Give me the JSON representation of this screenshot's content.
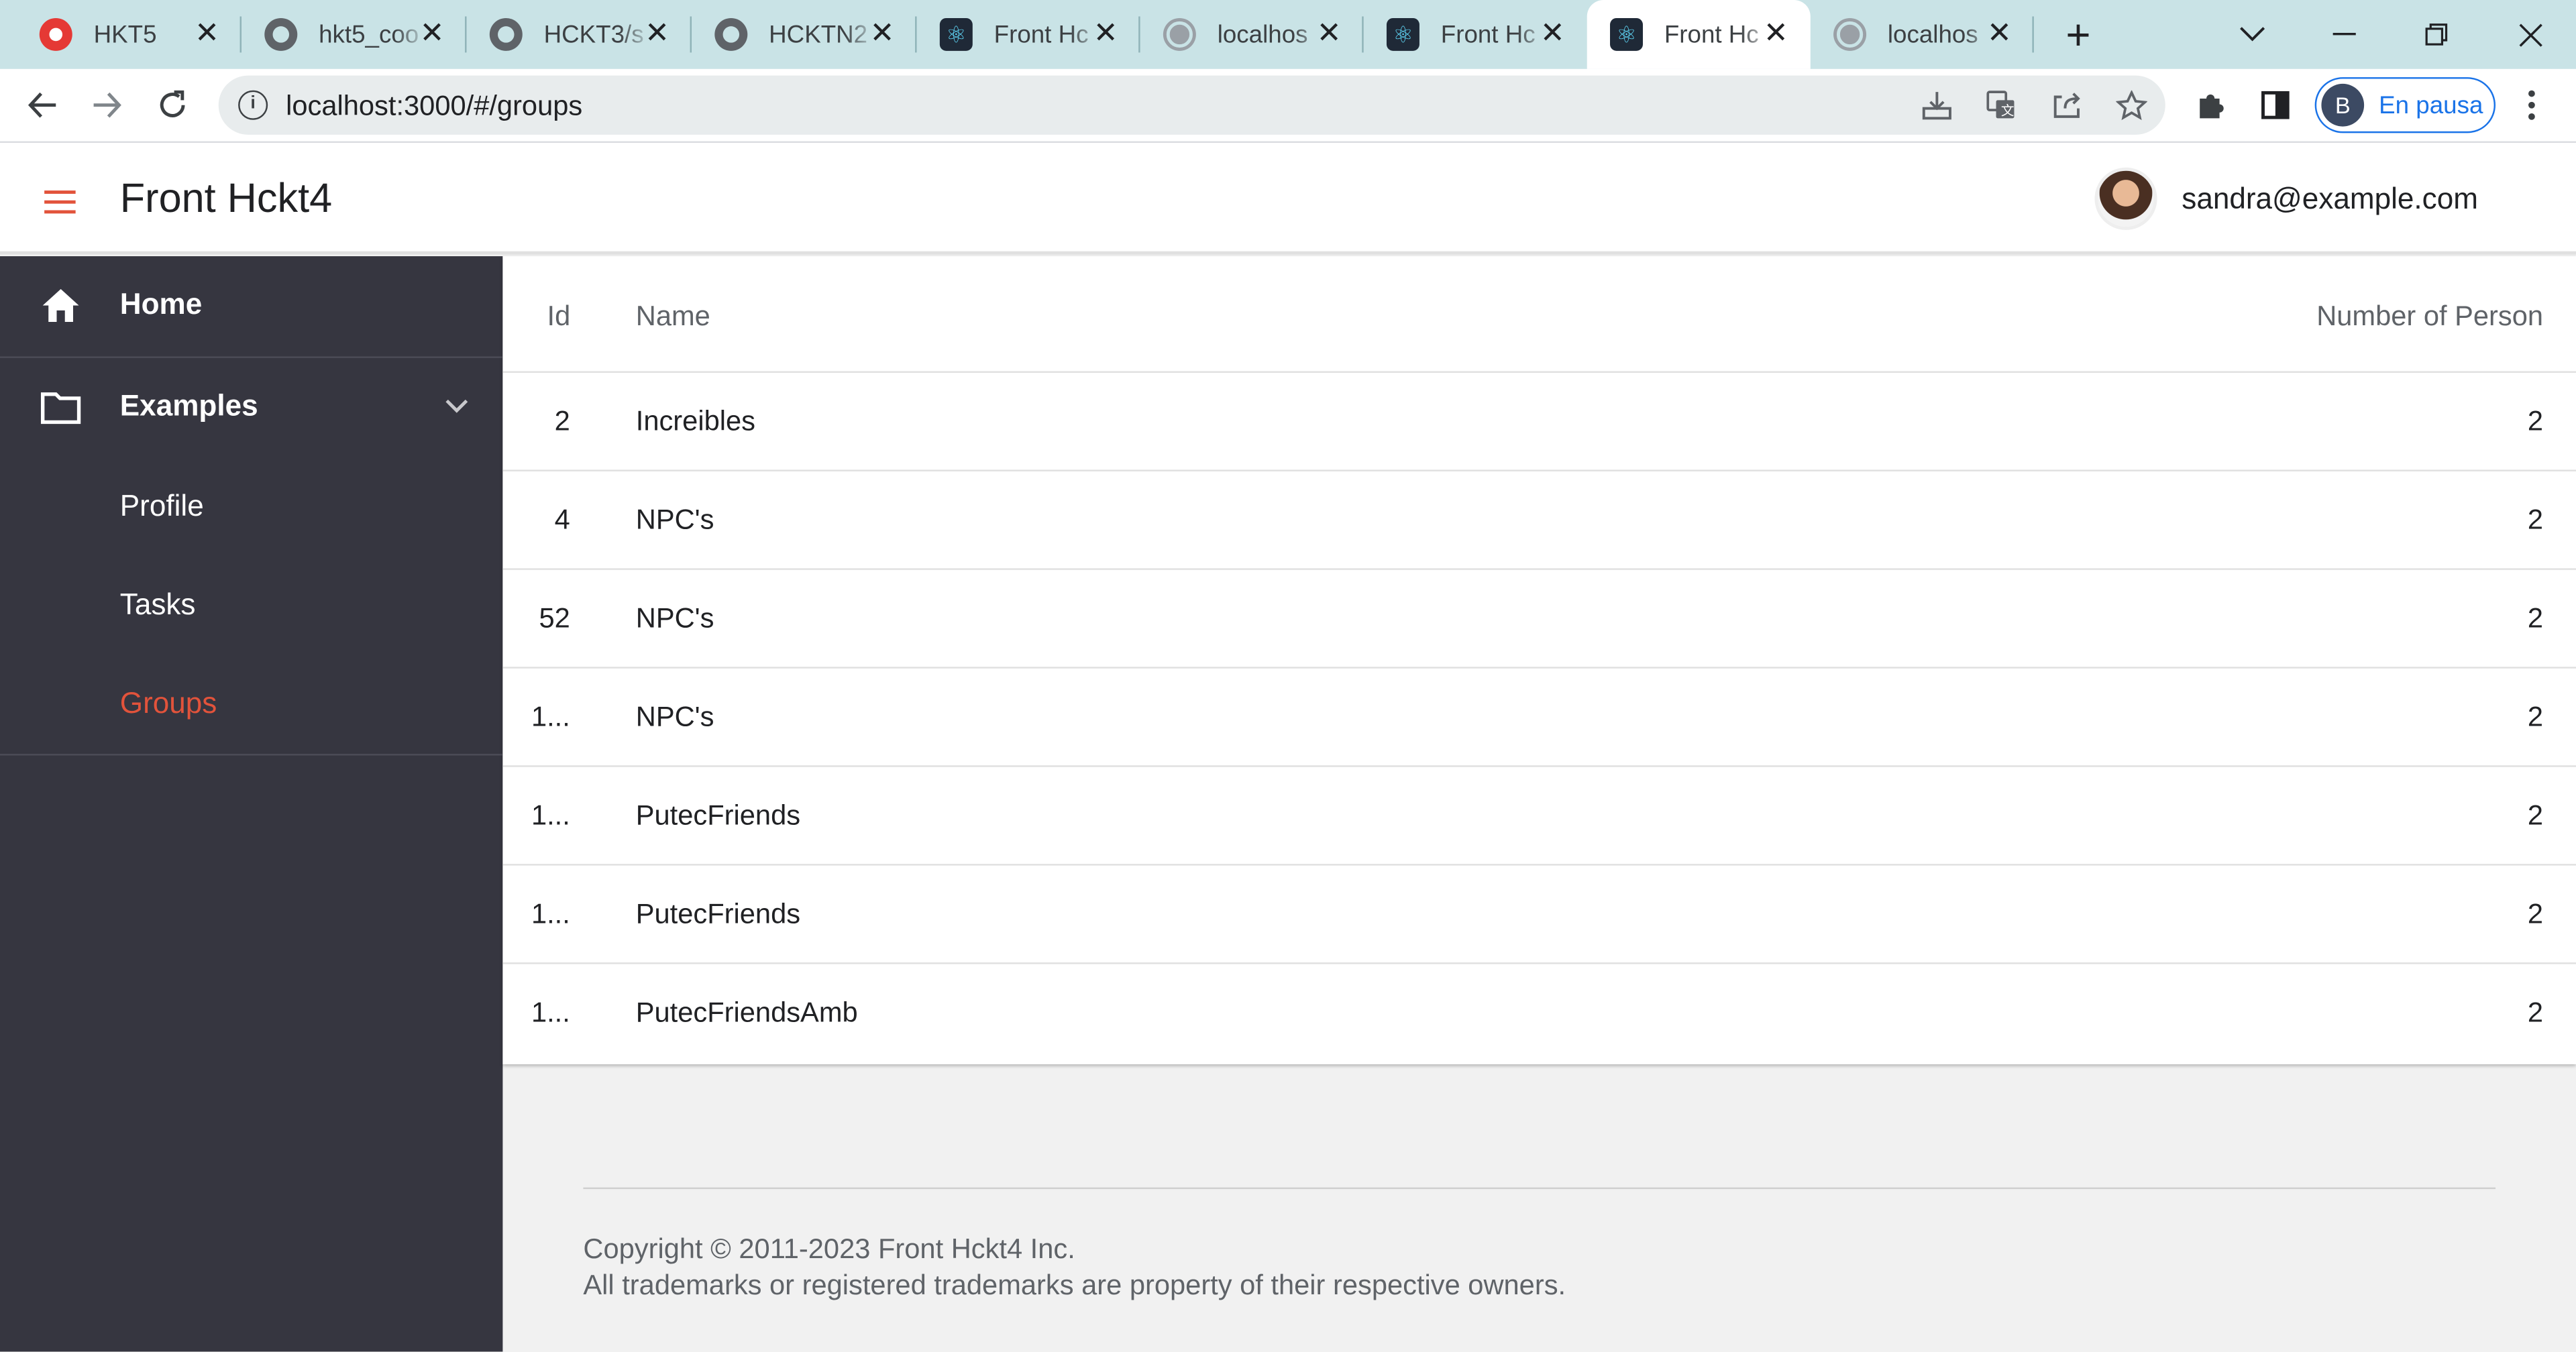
{
  "browser": {
    "tabs": [
      {
        "title": "HKT5",
        "icon": "hkt-favicon",
        "active": false
      },
      {
        "title": "hkt5_coo",
        "icon": "github-favicon",
        "active": false
      },
      {
        "title": "HCKT3/s",
        "icon": "github-favicon",
        "active": false
      },
      {
        "title": "HCKTN2",
        "icon": "github-favicon",
        "active": false
      },
      {
        "title": "Front Hc",
        "icon": "react-favicon",
        "active": false
      },
      {
        "title": "localhos",
        "icon": "globe-favicon",
        "active": false
      },
      {
        "title": "Front Hc",
        "icon": "react-favicon",
        "active": false
      },
      {
        "title": "Front Hc",
        "icon": "react-favicon",
        "active": true
      },
      {
        "title": "localhos",
        "icon": "globe-favicon",
        "active": false
      }
    ],
    "url": "localhost:3000/#/groups",
    "profile_initial": "B",
    "profile_status": "En pausa",
    "accent": "#1a73e8",
    "tabstrip_color": "#c9e3e6"
  },
  "app": {
    "title": "Front Hckt4",
    "user_email": "sandra@example.com",
    "accent": "#e2533b"
  },
  "sidebar": {
    "items": [
      {
        "label": "Home",
        "icon": "home-icon"
      },
      {
        "label": "Examples",
        "icon": "folder-icon",
        "expanded": true
      },
      {
        "label": "Profile"
      },
      {
        "label": "Tasks"
      },
      {
        "label": "Groups",
        "selected": true
      }
    ]
  },
  "table": {
    "columns": [
      "Id",
      "Name",
      "Number of Person"
    ],
    "rows": [
      {
        "id": "2",
        "name": "Increibles",
        "count": "2"
      },
      {
        "id": "4",
        "name": "NPC's",
        "count": "2"
      },
      {
        "id": "52",
        "name": "NPC's",
        "count": "2"
      },
      {
        "id": "1...",
        "name": "NPC's",
        "count": "2"
      },
      {
        "id": "1...",
        "name": "PutecFriends",
        "count": "2"
      },
      {
        "id": "1...",
        "name": "PutecFriends",
        "count": "2"
      },
      {
        "id": "1...",
        "name": "PutecFriendsAmb",
        "count": "2"
      }
    ]
  },
  "footer": {
    "copyright": "Copyright © 2011-2023 Front Hckt4 Inc.",
    "trademarks": "All trademarks or registered trademarks are property of their respective owners."
  }
}
